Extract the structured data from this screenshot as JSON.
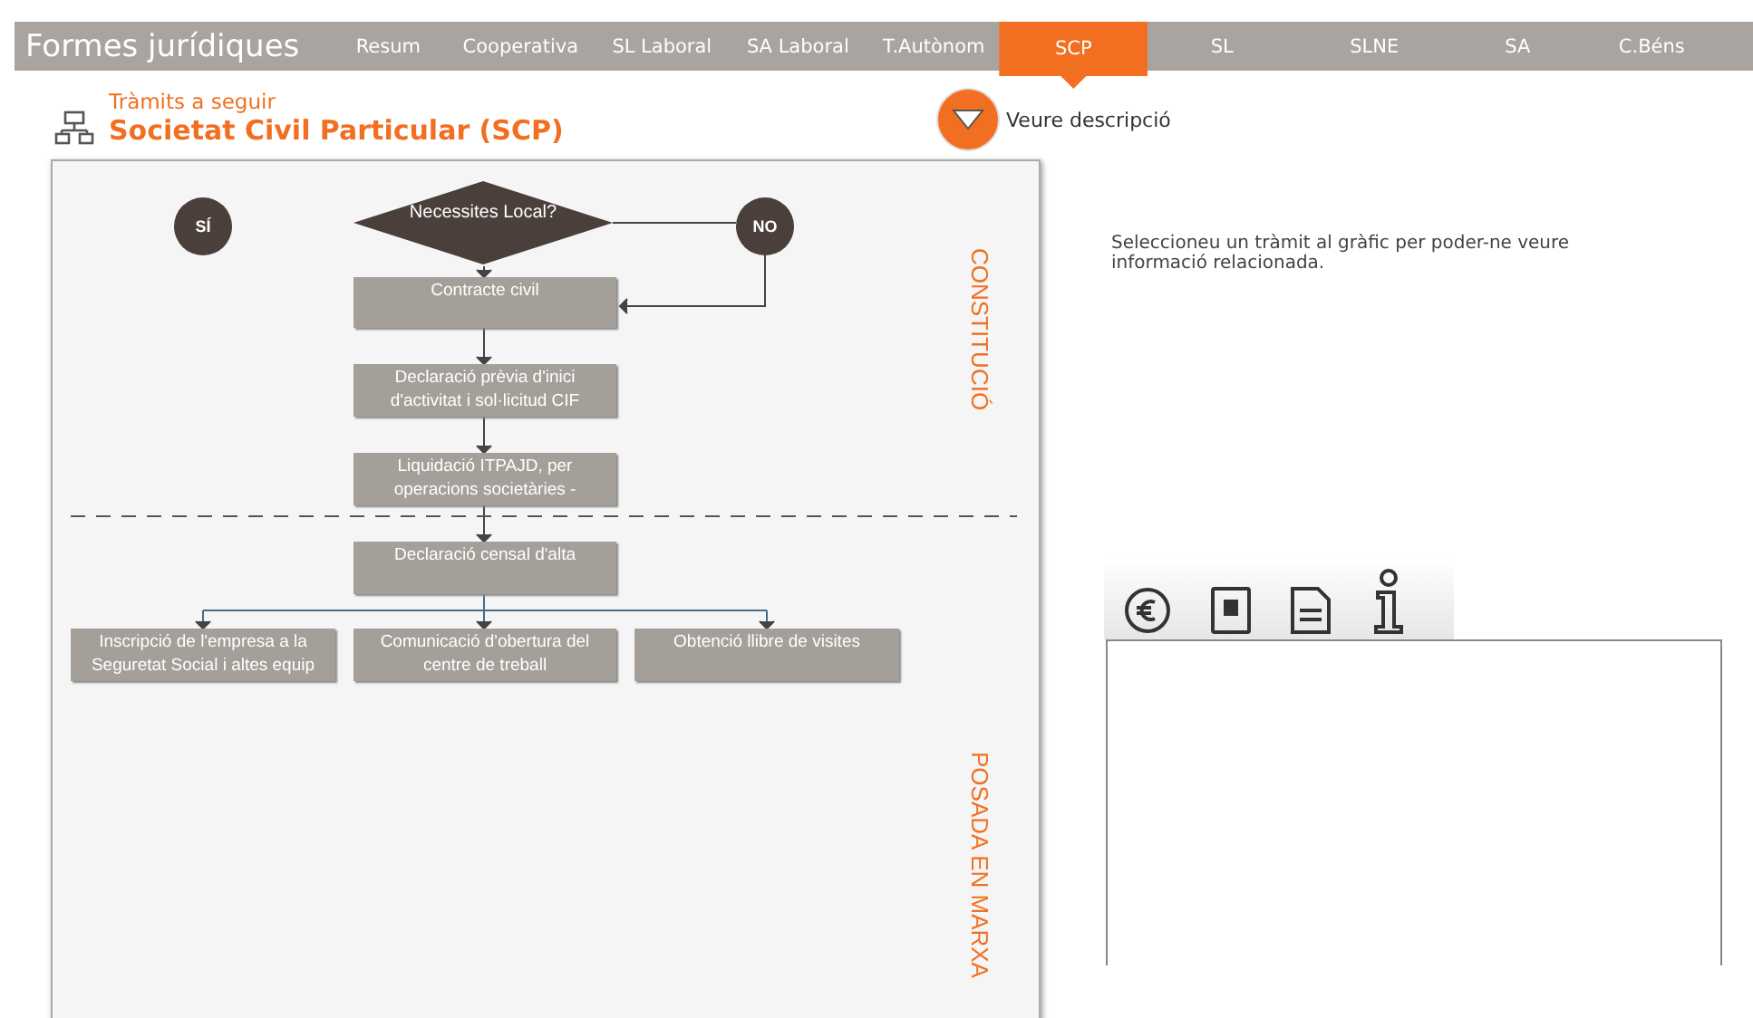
{
  "nav": {
    "title": "Formes jurídiques",
    "tabs": [
      {
        "label": "Resum",
        "selected": false
      },
      {
        "label": "Cooperativa",
        "selected": false
      },
      {
        "label": "SL Laboral",
        "selected": false
      },
      {
        "label": "SA Laboral",
        "selected": false
      },
      {
        "label": "T.Autònom",
        "selected": false
      },
      {
        "label": "SCP",
        "selected": true
      },
      {
        "label": "SL",
        "selected": false
      },
      {
        "label": "SLNE",
        "selected": false
      },
      {
        "label": "SA",
        "selected": false
      },
      {
        "label": "C.Béns",
        "selected": false
      }
    ]
  },
  "header": {
    "subtitle": "Tràmits a seguir",
    "title": "Societat Civil Particular (SCP)",
    "description_button": "Veure descripció"
  },
  "flowchart": {
    "yes": "SÍ",
    "decision": "Necessites Local?",
    "no": "NO",
    "steps": [
      {
        "label": "Contracte civil"
      },
      {
        "label": "Declaració prèvia d'inici d'activitat i sol·licitud CIF"
      },
      {
        "label": "Liquidació ITPAJD, per operacions societàries -"
      },
      {
        "label": "Declaració censal d'alta"
      },
      {
        "label": "Inscripció de l'empresa a la Seguretat Social i altes equip"
      },
      {
        "label": "Comunicació d'obertura del centre de treball"
      },
      {
        "label": "Obtenció llibre de visites"
      }
    ],
    "phases": [
      "CONSTITUCIÓ",
      "POSADA EN MARXA"
    ]
  },
  "info_text": "Seleccioneu un tràmit al gràfic per poder-ne veure informació relacionada."
}
